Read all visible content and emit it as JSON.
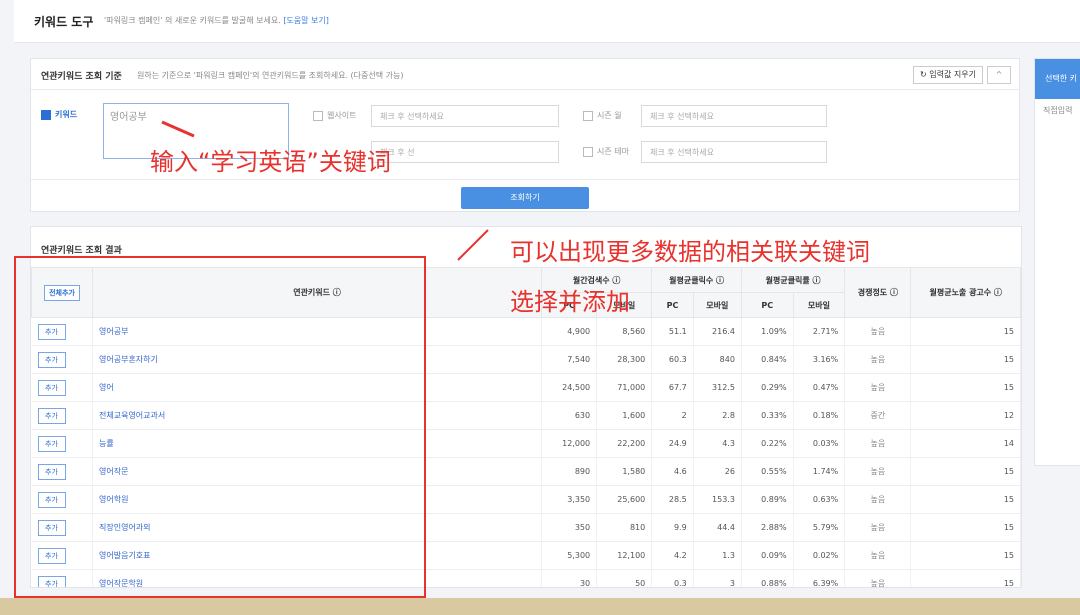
{
  "header": {
    "title": "키워드 도구",
    "description": "'파워링크 캠페인' 의 새로운 키워드를 발굴해 보세요.",
    "help_link": "[도움말 보기]"
  },
  "criteria": {
    "title": "연관키워드 조회 기준",
    "subtitle": "원하는 기준으로 '파워링크 캠페인'의 연관키워드를 조회하세요. (다중선택 가능)",
    "reset_label": "입력값 지우기",
    "collapse_label": "^",
    "keyword_label": "키워드",
    "keyword_value": "영어공부",
    "website_label": "웹사이트",
    "website_placeholder": "체크 후 선택하세요",
    "season_month_label": "시즌 월",
    "season_month_placeholder": "체크 후 선택하세요",
    "season_theme_label": "시즌 테마",
    "season_theme_placeholder": "체크 후 선택하세요",
    "hidden_placeholder": "체크 후 선",
    "search_button": "조회하기"
  },
  "results": {
    "title": "연관키워드 조회 결과",
    "all_add": "전체추가",
    "headers": {
      "keyword": "연관키워드 ⓘ",
      "monthly_search": "월간검색수 ⓘ",
      "monthly_click": "월평균클릭수 ⓘ",
      "monthly_ctr": "월평균클릭률 ⓘ",
      "competition": "경쟁정도 ⓘ",
      "ad_count": "월평균노출 광고수 ⓘ",
      "pc": "PC",
      "mobile": "모바일"
    },
    "add_label": "추가",
    "rows": [
      {
        "kw": "영어공부",
        "pc": "4,900",
        "mo": "8,560",
        "cpc": "51.1",
        "cmo": "216.4",
        "rpc": "1.09%",
        "rmo": "2.71%",
        "comp": "높음",
        "ads": "15"
      },
      {
        "kw": "영어공부혼자하기",
        "pc": "7,540",
        "mo": "28,300",
        "cpc": "60.3",
        "cmo": "840",
        "rpc": "0.84%",
        "rmo": "3.16%",
        "comp": "높음",
        "ads": "15"
      },
      {
        "kw": "영어",
        "pc": "24,500",
        "mo": "71,000",
        "cpc": "67.7",
        "cmo": "312.5",
        "rpc": "0.29%",
        "rmo": "0.47%",
        "comp": "높음",
        "ads": "15"
      },
      {
        "kw": "전체교육영어교과서",
        "pc": "630",
        "mo": "1,600",
        "cpc": "2",
        "cmo": "2.8",
        "rpc": "0.33%",
        "rmo": "0.18%",
        "comp": "중간",
        "ads": "12"
      },
      {
        "kw": "능률",
        "pc": "12,000",
        "mo": "22,200",
        "cpc": "24.9",
        "cmo": "4.3",
        "rpc": "0.22%",
        "rmo": "0.03%",
        "comp": "높음",
        "ads": "14"
      },
      {
        "kw": "영어작문",
        "pc": "890",
        "mo": "1,580",
        "cpc": "4.6",
        "cmo": "26",
        "rpc": "0.55%",
        "rmo": "1.74%",
        "comp": "높음",
        "ads": "15"
      },
      {
        "kw": "영어학원",
        "pc": "3,350",
        "mo": "25,600",
        "cpc": "28.5",
        "cmo": "153.3",
        "rpc": "0.89%",
        "rmo": "0.63%",
        "comp": "높음",
        "ads": "15"
      },
      {
        "kw": "직장인영어과외",
        "pc": "350",
        "mo": "810",
        "cpc": "9.9",
        "cmo": "44.4",
        "rpc": "2.88%",
        "rmo": "5.79%",
        "comp": "높음",
        "ads": "15"
      },
      {
        "kw": "영어발음기호표",
        "pc": "5,300",
        "mo": "12,100",
        "cpc": "4.2",
        "cmo": "1.3",
        "rpc": "0.09%",
        "rmo": "0.02%",
        "comp": "높음",
        "ads": "15"
      },
      {
        "kw": "영어작문학원",
        "pc": "30",
        "mo": "50",
        "cpc": "0.3",
        "cmo": "3",
        "rpc": "0.88%",
        "rmo": "6.39%",
        "comp": "높음",
        "ads": "15"
      }
    ]
  },
  "side": {
    "head": "선택한 키",
    "sub": "직접입력"
  },
  "annotations": {
    "a1": "输入“学习英语”关键词",
    "a2": "可以出现更多数据的相关联关键词",
    "a3": "选择并添加"
  },
  "colors": {
    "accent": "#4a90e2",
    "annotation": "#e8322e"
  }
}
